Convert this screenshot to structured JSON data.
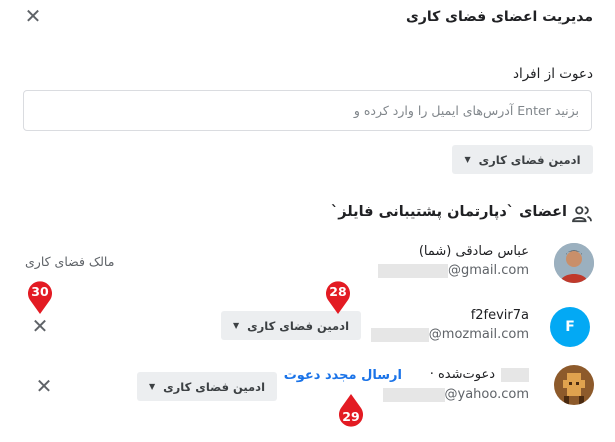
{
  "dialog": {
    "title": "مدیریت اعضای فضای کاری",
    "close_glyph": "✕"
  },
  "invite": {
    "label": "دعوت از افراد",
    "placeholder": "بزنید Enter آدرس‌های ایمیل را وارد کرده و",
    "value": "",
    "role_label": "ادمین فضای کاری"
  },
  "members": {
    "heading": "اعضای `دپارتمان پشتیبانی فایلز`",
    "icon": "people-icon",
    "owner_label": "مالک فضای کاری",
    "list": [
      {
        "name": "عباس صادقی (شما)",
        "email_suffix": "@gmail.com",
        "avatar": "photo-avatar",
        "avatar_color": "#8a9aa8"
      },
      {
        "name": "f2fevir7a",
        "email_suffix": "@mozmail.com",
        "avatar_letter": "F",
        "avatar_color": "#03a9f4",
        "role_label": "ادمین فضای کاری"
      },
      {
        "status": "دعوت‌شده ·",
        "resend_label": "ارسال مجدد دعوت",
        "email_suffix": "@yahoo.com",
        "avatar": "pixel-avatar",
        "avatar_color": "#8d5a2b",
        "role_label": "ادمین فضای کاری"
      }
    ]
  },
  "markers": [
    {
      "number": "30",
      "color": "#e31b23"
    },
    {
      "number": "28",
      "color": "#e31b23"
    },
    {
      "number": "29",
      "color": "#e31b23"
    }
  ],
  "remove_glyph": "✕",
  "caret_glyph": "▼"
}
